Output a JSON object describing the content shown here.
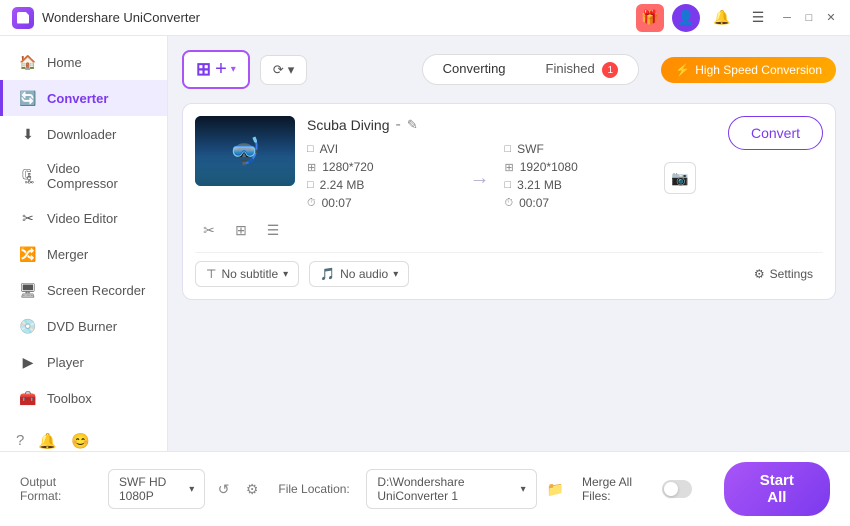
{
  "app": {
    "title": "Wondershare UniConverter",
    "logo_alt": "WU"
  },
  "titlebar": {
    "controls": [
      "gift",
      "user",
      "bell",
      "menu",
      "minimize",
      "maximize",
      "close"
    ]
  },
  "sidebar": {
    "items": [
      {
        "id": "home",
        "label": "Home",
        "icon": "🏠"
      },
      {
        "id": "converter",
        "label": "Converter",
        "icon": "🔄"
      },
      {
        "id": "downloader",
        "label": "Downloader",
        "icon": "⬇"
      },
      {
        "id": "video-compressor",
        "label": "Video Compressor",
        "icon": "🗜"
      },
      {
        "id": "video-editor",
        "label": "Video Editor",
        "icon": "✂"
      },
      {
        "id": "merger",
        "label": "Merger",
        "icon": "🔀"
      },
      {
        "id": "screen-recorder",
        "label": "Screen Recorder",
        "icon": "🖥"
      },
      {
        "id": "dvd-burner",
        "label": "DVD Burner",
        "icon": "💿"
      },
      {
        "id": "player",
        "label": "Player",
        "icon": "▶"
      },
      {
        "id": "toolbox",
        "label": "Toolbox",
        "icon": "🧰"
      }
    ],
    "collapse_label": "‹"
  },
  "toolbar": {
    "add_btn_label": "+",
    "add_btn_dropdown": "▾",
    "convert_from_label": "⟳",
    "convert_from_dropdown": "▾",
    "tabs": [
      {
        "id": "converting",
        "label": "Converting"
      },
      {
        "id": "finished",
        "label": "Finished",
        "badge": "1"
      }
    ],
    "speed_btn": {
      "label": "High Speed Conversion",
      "icon": "⚡"
    }
  },
  "file_card": {
    "name": "Scuba Diving",
    "edit_icon": "✎",
    "source": {
      "format": "AVI",
      "size": "2.24 MB",
      "resolution": "1280*720",
      "duration": "00:07"
    },
    "target": {
      "format": "SWF",
      "size": "3.21 MB",
      "resolution": "1920*1080",
      "duration": "00:07"
    },
    "arrow": "→",
    "subtitle_label": "No subtitle",
    "audio_label": "No audio",
    "settings_label": "Settings",
    "convert_btn": "Convert",
    "action_icons": [
      "✂",
      "⊞",
      "☰"
    ]
  },
  "bottom_bar": {
    "output_format_label": "Output Format:",
    "output_format_value": "SWF HD 1080P",
    "file_location_label": "File Location:",
    "file_location_value": "D:\\Wondershare UniConverter 1",
    "merge_label": "Merge All Files:",
    "start_all_label": "Start All",
    "refresh_icon": "↺",
    "settings_icon": "⚙",
    "folder_icon": "📁"
  },
  "status_bar": {
    "icons": [
      "?",
      "🔔",
      "😊"
    ]
  },
  "colors": {
    "accent": "#7c3aed",
    "accent_light": "#a855f7",
    "orange": "#ff8c00"
  }
}
